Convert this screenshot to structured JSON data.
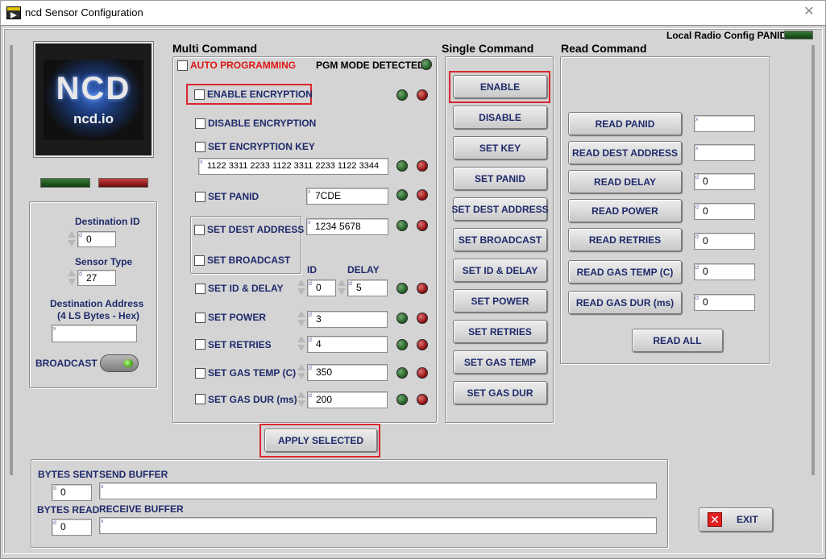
{
  "window": {
    "title": "ncd Sensor Configuration",
    "close_glyph": "✕"
  },
  "logo": {
    "mark": "NCD",
    "url": "ncd.io"
  },
  "top_right": {
    "label": "Local Radio Config PANID"
  },
  "left": {
    "destination_id": {
      "label": "Destination ID",
      "value": "0"
    },
    "sensor_type": {
      "label": "Sensor Type",
      "value": "27"
    },
    "destination_address": {
      "label_line1": "Destination Address",
      "label_line2": "(4 LS Bytes - Hex)",
      "value": ""
    },
    "broadcast": {
      "label": "BROADCAST",
      "on": true
    }
  },
  "multi": {
    "heading": "Multi Command",
    "auto_programming": "AUTO PROGRAMMING",
    "pgm_mode": "PGM MODE DETECTED",
    "enable_encryption": "ENABLE ENCRYPTION",
    "disable_encryption": "DISABLE ENCRYPTION",
    "set_encryption_key": "SET ENCRYPTION KEY",
    "encryption_key_value": "1122 3311 2233 1122 3311 2233 1122 3344",
    "set_panid": "SET PANID",
    "panid_value": "7CDE",
    "set_dest_address": "SET DEST ADDRESS",
    "dest_address_value": "1234 5678",
    "set_broadcast": "SET BROADCAST",
    "id_header": "ID",
    "delay_header": "DELAY",
    "set_id_delay": "SET ID & DELAY",
    "id_value": "0",
    "delay_value": "5",
    "set_power": "SET POWER",
    "power_value": "3",
    "set_retries": "SET RETRIES",
    "retries_value": "4",
    "set_gas_temp": "SET GAS TEMP (C)",
    "gas_temp_value": "350",
    "set_gas_dur": "SET GAS DUR (ms)",
    "gas_dur_value": "200",
    "apply": "APPLY SELECTED"
  },
  "single": {
    "heading": "Single Command",
    "buttons": [
      "ENABLE",
      "DISABLE",
      "SET KEY",
      "SET PANID",
      "SET DEST ADDRESS",
      "SET BROADCAST",
      "SET ID & DELAY",
      "SET POWER",
      "SET RETRIES",
      "SET GAS TEMP",
      "SET GAS DUR"
    ]
  },
  "read": {
    "heading": "Read Command",
    "rows": [
      {
        "label": "READ PANID",
        "value": ""
      },
      {
        "label": "READ DEST ADDRESS",
        "value": ""
      },
      {
        "label": "READ DELAY",
        "value": "0"
      },
      {
        "label": "READ POWER",
        "value": "0"
      },
      {
        "label": "READ RETRIES",
        "value": "0"
      },
      {
        "label": "READ GAS TEMP (C)",
        "value": "0"
      },
      {
        "label": "READ GAS DUR  (ms)",
        "value": "0"
      }
    ],
    "read_all": "READ ALL"
  },
  "bottom": {
    "bytes_sent": {
      "label": "BYTES SENT",
      "value": "0"
    },
    "bytes_read": {
      "label": "BYTES READ",
      "value": "0"
    },
    "send_buffer": {
      "label": "SEND BUFFER",
      "value": ""
    },
    "receive_buffer": {
      "label": "RECEIVE BUFFER",
      "value": ""
    },
    "exit": "EXIT",
    "exit_glyph": "✕"
  },
  "field_tags": {
    "string": "x",
    "numeric": "d"
  },
  "colors": {
    "label_blue": "#1f2a6b",
    "alert_red": "#e01515",
    "highlight": "#d9262e",
    "panel": "#d4d4d4"
  }
}
